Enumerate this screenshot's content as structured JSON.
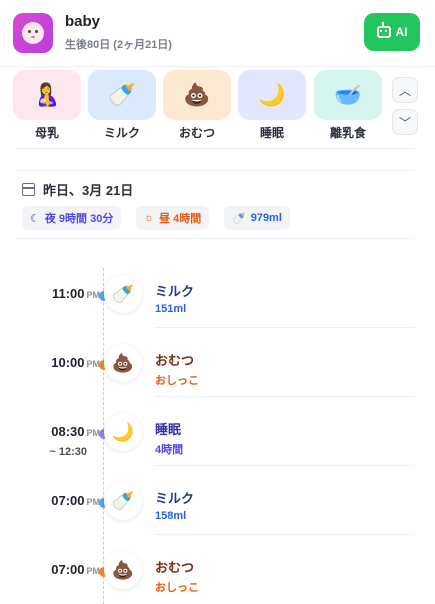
{
  "header": {
    "baby_name": "baby",
    "baby_age": "生後80日 (2ヶ月21日)",
    "ai_label": "AI",
    "accent": "#22c55e",
    "avatar_color": "#c743d9"
  },
  "categories": [
    {
      "label": "母乳",
      "icon": "breastfeeding-icon",
      "glyph": "🤱",
      "bg": "#fde7ef"
    },
    {
      "label": "ミルク",
      "icon": "baby-bottle-icon",
      "glyph": "🍼",
      "bg": "#dbe9fb"
    },
    {
      "label": "おむつ",
      "icon": "poop-icon",
      "glyph": "💩",
      "bg": "#fde8d2"
    },
    {
      "label": "睡眠",
      "icon": "moon-icon",
      "glyph": "🌙",
      "bg": "#e4e6fb"
    },
    {
      "label": "離乳食",
      "icon": "baby-food-bowl-icon",
      "glyph": "🥣",
      "bg": "#d6f5ee"
    }
  ],
  "nav": {
    "up_icon": "chevron-up-icon",
    "down_icon": "chevron-down-icon",
    "up_glyph": "︿",
    "down_glyph": "﹀"
  },
  "summary": {
    "date": "昨日、3月 21日",
    "night": "夜 9時間 30分",
    "day": "昼 4時間",
    "milk_total": "979ml",
    "night_color": "#4f46e5",
    "day_color": "#ea580c",
    "milk_color": "#2563eb"
  },
  "timeline": [
    {
      "time": "11:00",
      "ampm": "PM",
      "end": "",
      "title": "ミルク",
      "sub": "151ml",
      "type": "milk",
      "glyph": "🍼",
      "dot": "#4fa3f0",
      "title_color": "#1e3a8a",
      "sub_color": "#2563eb"
    },
    {
      "time": "10:00",
      "ampm": "PM",
      "end": "",
      "title": "おむつ",
      "sub": "おしっこ",
      "type": "diaper",
      "glyph": "💩",
      "dot": "#f08a18",
      "title_color": "#7c2d12",
      "sub_color": "#ea580c"
    },
    {
      "time": "08:30",
      "ampm": "PM",
      "end": "~ 12:30",
      "title": "睡眠",
      "sub": "4時間",
      "type": "sleep",
      "glyph": "🌙",
      "dot": "#8b82ec",
      "title_color": "#3730a3",
      "sub_color": "#4f46e5"
    },
    {
      "time": "07:00",
      "ampm": "PM",
      "end": "",
      "title": "ミルク",
      "sub": "158ml",
      "type": "milk",
      "glyph": "🍼",
      "dot": "#4fa3f0",
      "title_color": "#1e3a8a",
      "sub_color": "#2563eb"
    },
    {
      "time": "07:00",
      "ampm": "PM",
      "end": "",
      "title": "おむつ",
      "sub": "おしっこ",
      "type": "diaper",
      "glyph": "💩",
      "dot": "#f08a18",
      "title_color": "#7c2d12",
      "sub_color": "#ea580c"
    }
  ]
}
